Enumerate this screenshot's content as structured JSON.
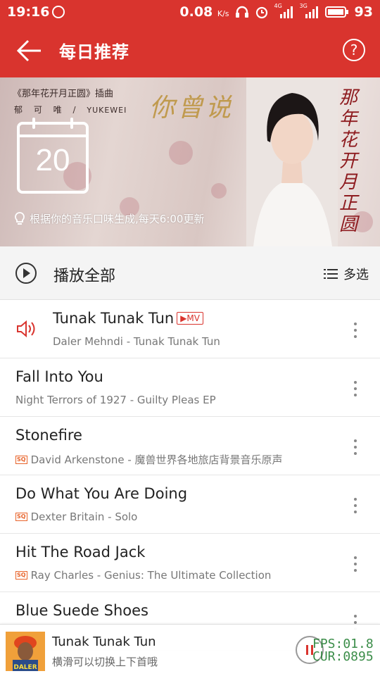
{
  "status_bar": {
    "time": "19:16",
    "speed": "0.08",
    "speed_unit": "K/s",
    "net1": "4G",
    "net2": "3G",
    "battery": "93"
  },
  "app_bar": {
    "title": "每日推荐",
    "help_icon": "?",
    "color": "#d9342e"
  },
  "banner": {
    "caption_line1": "《那年花开月正圆》插曲",
    "caption_artist": "郁 可 唯",
    "caption_separator": "/",
    "caption_artist_en": "YUKEWEI",
    "song_art_title": "你曾说",
    "album_art_title": "那年花开月正圆",
    "calendar_day": "20",
    "note": "根据你的音乐口味生成,每天6:00更新"
  },
  "play_all": {
    "label": "播放全部",
    "multi_select_label": "多选"
  },
  "songs": [
    {
      "title": "Tunak Tunak Tun",
      "mv": "MV",
      "subtitle": "Daler Mehndi - Tunak Tunak Tun",
      "playing": true,
      "sq": false
    },
    {
      "title": "Fall Into You",
      "subtitle": "Night Terrors of 1927 - Guilty Pleas   EP",
      "playing": false,
      "sq": false
    },
    {
      "title": "Stonefire",
      "subtitle": "David Arkenstone - 魔兽世界各地旅店背景音乐原声",
      "playing": false,
      "sq": true
    },
    {
      "title": "Do What You Are Doing",
      "subtitle": "Dexter Britain - Solo",
      "playing": false,
      "sq": true
    },
    {
      "title": "Hit The Road Jack",
      "subtitle": "Ray Charles - Genius: The Ultimate Collection",
      "playing": false,
      "sq": true
    },
    {
      "title": "Blue Suede Shoes",
      "subtitle": "",
      "playing": false,
      "sq": false
    }
  ],
  "sq_badge": "SQ",
  "mini_player": {
    "title": "Tunak Tunak Tun",
    "hint": "横滑可以切换上下首哦",
    "art_text": "DALER"
  },
  "debug_overlay": {
    "fps": "FPS:01.8",
    "cur": "CUR:0895"
  }
}
